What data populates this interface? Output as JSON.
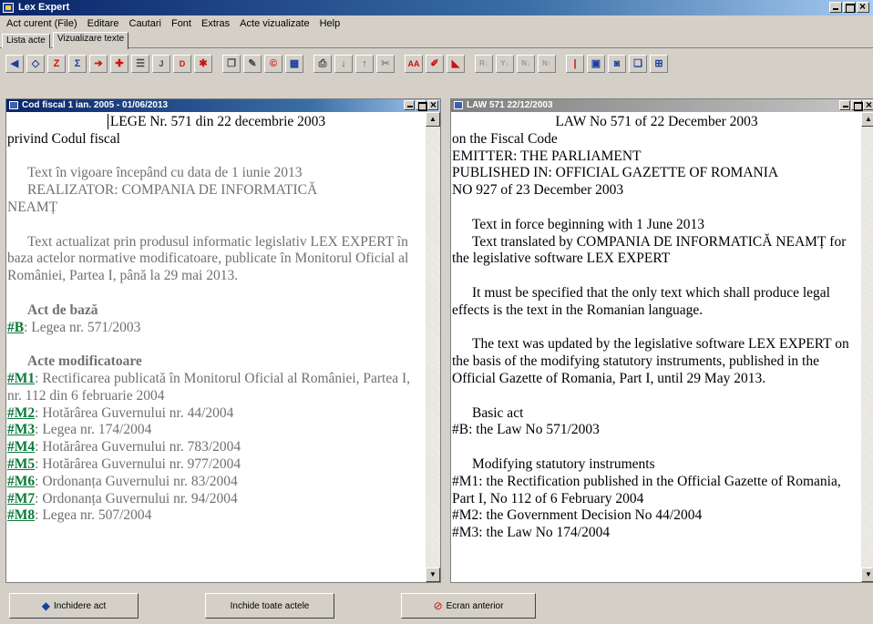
{
  "app": {
    "title": "Lex Expert"
  },
  "menu": [
    "Act curent (File)",
    "Editare",
    "Cautari",
    "Font",
    "Extras",
    "Acte vizualizate",
    "Help"
  ],
  "tabs": [
    {
      "label": "Lista acte",
      "active": false
    },
    {
      "label": "Vizualizare texte",
      "active": true
    }
  ],
  "toolbar": {
    "buttons": [
      "back-icon",
      "eraser-icon",
      "z-icon",
      "sigma-icon",
      "export-icon",
      "insert-icon",
      "list-icon",
      "print-preview-icon",
      "chart-icon",
      "star-icon",
      "copy-icon",
      "edit-icon",
      "circle-c-icon",
      "calendar-icon",
      "printer-icon",
      "arrow-down-icon",
      "arrow-up-icon",
      "scissors-icon",
      "aa-icon",
      "pen-icon",
      "marker-icon",
      "sort1-icon",
      "sort2-icon",
      "sort3-icon",
      "sort4-icon",
      "bar-icon",
      "window1-icon",
      "window2-icon",
      "window3-icon",
      "grid-icon"
    ]
  },
  "left_doc": {
    "title": "Cod fiscal 1 ian. 2005 - 01/06/2013",
    "heading": "LEGE   Nr. 571 din 22 decembrie 2003",
    "subtitle": "privind Codul fiscal",
    "p1a": "Text în vigoare începând cu data de 1 iunie 2013",
    "p1b": "REALIZATOR: COMPANIA DE INFORMATICĂ",
    "p1c": "NEAMȚ",
    "p2": "Text actualizat prin produsul informatic legislativ LEX EXPERT în baza actelor normative modificatoare, publicate în Monitorul Oficial al României, Partea I, până la 29 mai 2013.",
    "base_heading": "Act de bază",
    "base_link": "#B",
    "base_text": ": Legea nr. 571/2003",
    "mod_heading": "Acte modificatoare",
    "mods": [
      {
        "link": "#M1",
        "text": ": Rectificarea publicată în Monitorul Oficial al României, Partea I, nr. 112 din 6 februarie 2004"
      },
      {
        "link": "#M2",
        "text": ": Hotărârea Guvernului nr. 44/2004"
      },
      {
        "link": "#M3",
        "text": ": Legea nr. 174/2004"
      },
      {
        "link": "#M4",
        "text": ": Hotărârea Guvernului nr. 783/2004"
      },
      {
        "link": "#M5",
        "text": ": Hotărârea Guvernului nr. 977/2004"
      },
      {
        "link": "#M6",
        "text": ": Ordonanța Guvernului nr. 83/2004"
      },
      {
        "link": "#M7",
        "text": ": Ordonanța Guvernului nr. 94/2004"
      },
      {
        "link": "#M8",
        "text": ": Legea nr. 507/2004"
      }
    ]
  },
  "right_doc": {
    "title": "LAW 571 22/12/2003",
    "heading": "LAW    No 571 of 22 December 2003",
    "lines": [
      "on the Fiscal Code",
      "EMITTER:    THE PARLIAMENT",
      "PUBLISHED  IN: OFFICIAL GAZETTE OF ROMANIA",
      "NO 927 of 23 December 2003"
    ],
    "p1a": "Text in force beginning with 1 June 2013",
    "p1b": "Text translated by COMPANIA DE INFORMATICĂ NEAMȚ for the legislative software LEX EXPERT",
    "p2": "It must be specified that the only text which shall produce legal effects is the text in the Romanian language.",
    "p3": "The text was updated by the legislative software LEX EXPERT on the basis of the modifying statutory instruments, published in the Official Gazette of Romania, Part I, until 29 May 2013.",
    "base_heading": "Basic act",
    "base_text": "#B: the Law No 571/2003",
    "mod_heading": "Modifying statutory instruments",
    "m1": "#M1: the Rectification published in the Official Gazette of Romania, Part I, No 112 of 6 February 2004",
    "m2": "#M2: the Government Decision No 44/2004",
    "m3": "#M3: the Law No 174/2004"
  },
  "bottom": {
    "close_act": "Inchidere act",
    "close_all": "Inchide toate actele",
    "previous": "Ecran anterior"
  }
}
